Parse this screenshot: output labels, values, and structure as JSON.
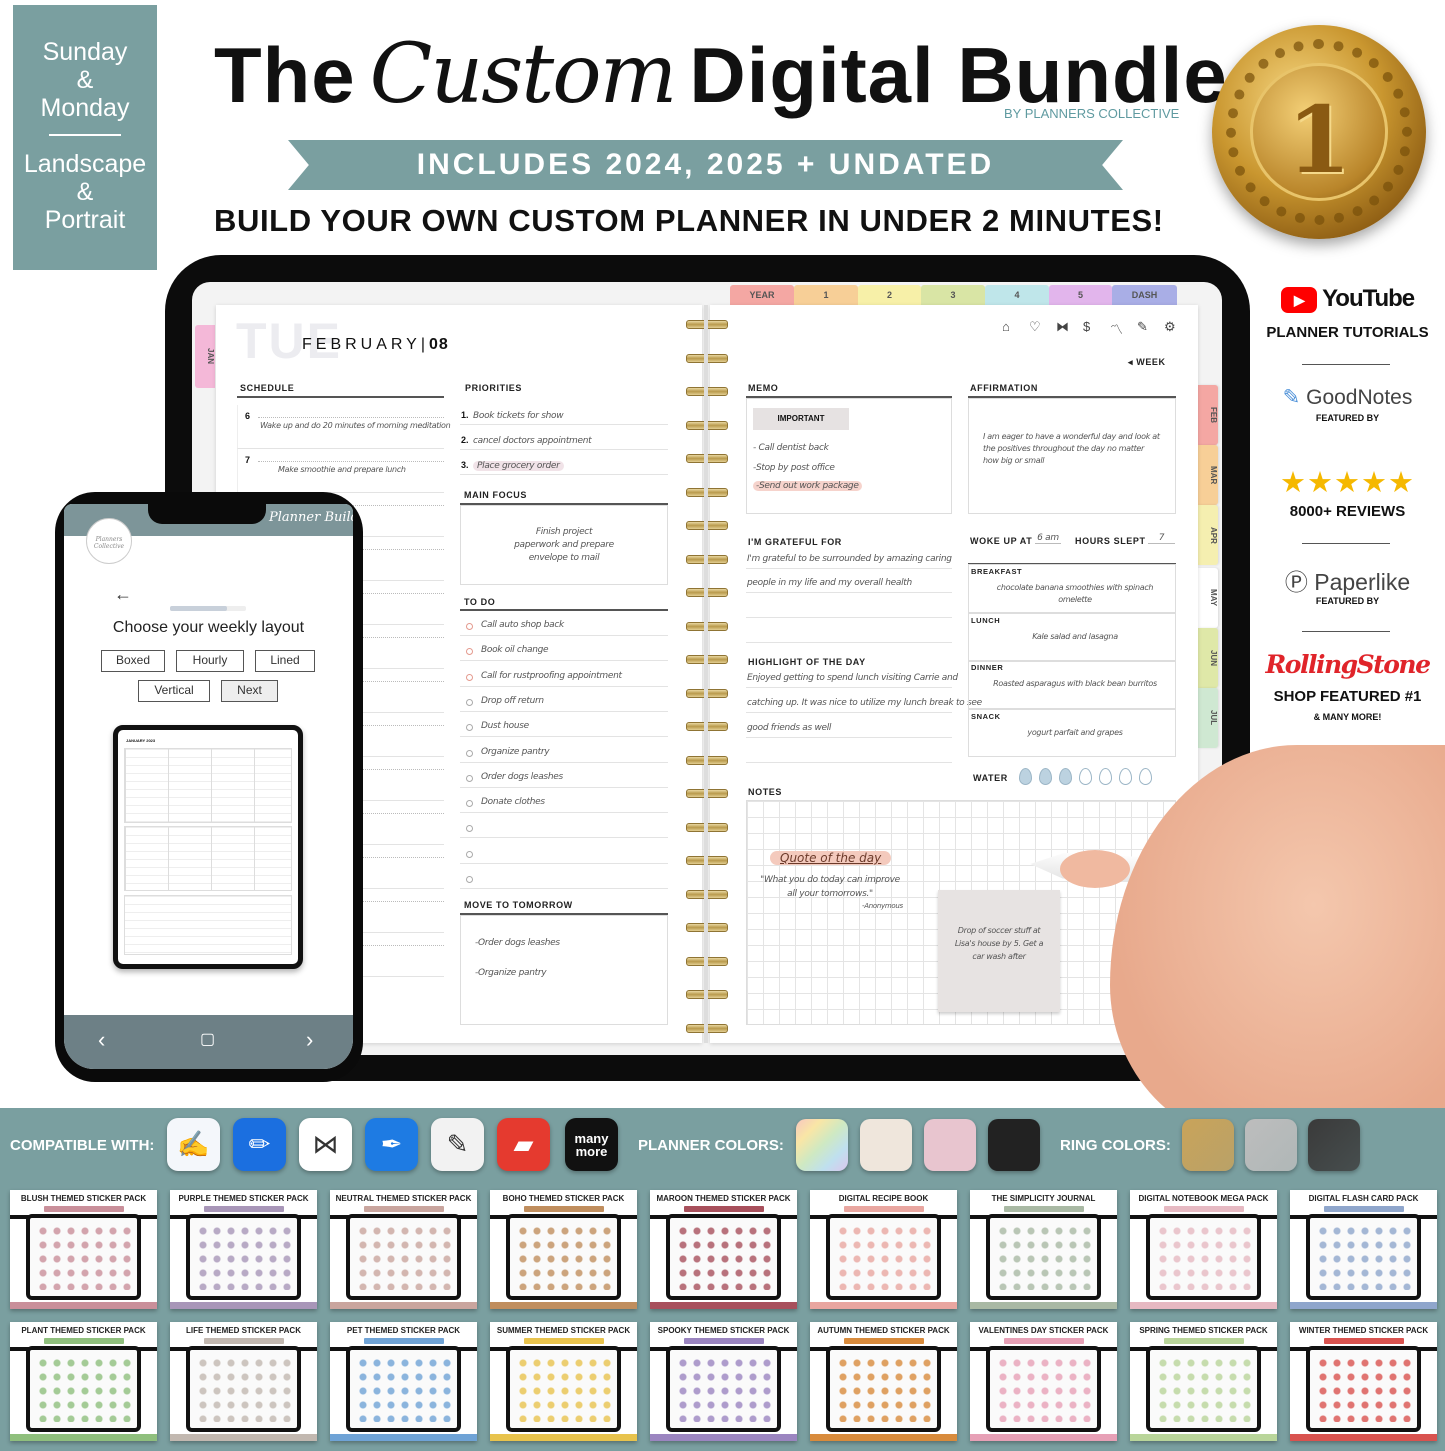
{
  "badge": {
    "line1": "Sunday",
    "line2": "&",
    "line3": "Monday",
    "line4": "Landscape",
    "line5": "&",
    "line6": "Portrait"
  },
  "header": {
    "title_pre": "The",
    "title_script": "Custom",
    "title_post": "Digital Bundle",
    "byline": "BY PLANNERS COLLECTIVE",
    "ribbon": "INCLUDES 2024, 2025 + UNDATED",
    "tagline": "BUILD YOUR OWN CUSTOM PLANNER IN UNDER 2 MINUTES!"
  },
  "medal": {
    "number": "1"
  },
  "sidebar": {
    "youtube": "YouTube",
    "tutorials": "PLANNER TUTORIALS",
    "goodnotes": "GoodNotes",
    "goodnotes_sub": "FEATURED BY",
    "stars": "★★★★★",
    "reviews": "8000+  REVIEWS",
    "paperlike": "Paperlike",
    "paperlike_sub": "FEATURED BY",
    "rollingstone": "RollingStone",
    "shop": "SHOP FEATURED #1",
    "more": "& MANY MORE!"
  },
  "planner": {
    "top_tabs": [
      {
        "label": "YEAR",
        "color": "#f4a7a3"
      },
      {
        "label": "1",
        "color": "#f7cf97"
      },
      {
        "label": "2",
        "color": "#f7f0a8"
      },
      {
        "label": "3",
        "color": "#d9e5a5"
      },
      {
        "label": "4",
        "color": "#bfe6ea"
      },
      {
        "label": "5",
        "color": "#e2b5ec"
      },
      {
        "label": "DASH",
        "color": "#a9aee6"
      }
    ],
    "side_tabs": [
      {
        "label": "FEB",
        "color": "#f4a7a3"
      },
      {
        "label": "MAR",
        "color": "#f7cf97"
      },
      {
        "label": "APR",
        "color": "#f5efb0"
      },
      {
        "label": "MAY",
        "color": "#ffffff"
      },
      {
        "label": "JUN",
        "color": "#dfe8a8"
      },
      {
        "label": "JUL",
        "color": "#cfe8d2"
      }
    ],
    "left_tab": {
      "label": "JAN",
      "color": "#f4b8d8"
    },
    "day": "TUE",
    "month": "FEBRUARY",
    "date": "08",
    "schedule": {
      "heading": "SCHEDULE",
      "rows": [
        {
          "hour": "6",
          "text": "Wake up and do 20 minutes of morning meditation"
        },
        {
          "hour": "7",
          "text": "Make smoothie and prepare lunch"
        }
      ]
    },
    "priorities": {
      "heading": "PRIORITIES",
      "items": [
        {
          "num": "1.",
          "text": "Book tickets for show"
        },
        {
          "num": "2.",
          "text": "cancel doctors appointment"
        },
        {
          "num": "3.",
          "text": "Place grocery order"
        }
      ]
    },
    "main_focus": {
      "heading": "MAIN FOCUS",
      "text": "Finish project paperwork and prepare envelope to mail"
    },
    "todo": {
      "heading": "TO DO",
      "items": [
        {
          "text": "Call auto shop back",
          "done": true
        },
        {
          "text": "Book oil change",
          "done": true
        },
        {
          "text": "Call for rustproofing appointment",
          "done": true
        },
        {
          "text": "Drop off return",
          "done": false
        },
        {
          "text": "Dust house",
          "done": false
        },
        {
          "text": "Organize pantry",
          "done": false
        },
        {
          "text": "Order dogs leashes",
          "done": false
        },
        {
          "text": "Donate clothes",
          "done": false
        },
        {
          "text": "",
          "done": false
        },
        {
          "text": "",
          "done": false
        },
        {
          "text": "",
          "done": false
        }
      ]
    },
    "move": {
      "heading": "MOVE TO TOMORROW",
      "items": [
        "-Order dogs leashes",
        "-Organize pantry"
      ]
    },
    "nav_icons": [
      "home-icon",
      "heart-icon",
      "dumbbell-icon",
      "dollar-icon",
      "chart-icon",
      "pencil-icon",
      "gear-icon"
    ],
    "nav_glyphs": [
      "⌂",
      "♡",
      "⧓",
      "$",
      "〽",
      "✎",
      "⚙"
    ],
    "week_link": "◂ WEEK",
    "memo": {
      "heading": "MEMO",
      "tag": "IMPORTANT",
      "items": [
        "- Call dentist back",
        "-Stop by post office",
        "-Send out work package"
      ]
    },
    "affirmation": {
      "heading": "AFFIRMATION",
      "text": "I am eager to have a wonderful day and look at the positives throughout the day no matter how big or small"
    },
    "grateful": {
      "heading": "I'M GRATEFUL FOR",
      "lines": [
        "I'm grateful to be surrounded by amazing caring",
        "people in my life and my overall health"
      ]
    },
    "highlight": {
      "heading": "HIGHLIGHT OF THE DAY",
      "lines": [
        "Enjoyed getting to spend lunch visiting Carrie and",
        "catching up. It was nice to utilize my lunch break to see",
        "good friends as well"
      ]
    },
    "sleep": {
      "woke_label": "WOKE UP AT",
      "woke_value": "6 am",
      "slept_label": "HOURS SLEPT",
      "slept_value": "7"
    },
    "meals": [
      {
        "label": "BREAKFAST",
        "text": "chocolate banana smoothies with spinach omelette"
      },
      {
        "label": "LUNCH",
        "text": "Kale salad and lasagna"
      },
      {
        "label": "DINNER",
        "text": "Roasted asparagus with black bean burritos"
      },
      {
        "label": "SNACK",
        "text": "yogurt parfait and grapes"
      }
    ],
    "water": {
      "label": "WATER",
      "filled": 3,
      "total": 7
    },
    "notes": {
      "heading": "NOTES",
      "quote_title": "Quote of the day",
      "quote": "\"What you do today can improve all your tomorrows.\"",
      "quote_author": "-Anonymous",
      "sticky": "Drop of soccer stuff at Lisa's house by 5. Get a car wash after"
    }
  },
  "phone": {
    "brand": "Planner Builder",
    "logo": "Planners Collective",
    "back": "←",
    "prompt": "Choose your weekly layout",
    "options": [
      "Boxed",
      "Hourly",
      "Lined",
      "Vertical",
      "Next"
    ],
    "progress": 0.75,
    "preview_title": "JANUARY 2023",
    "nav": [
      "‹",
      "▢",
      "›"
    ]
  },
  "compat": {
    "label": "COMPATIBLE WITH:",
    "apps": [
      {
        "name": "notes-app-icon",
        "glyph": "✍",
        "bg": "#f4f7fb"
      },
      {
        "name": "pencil-app-icon",
        "glyph": "✏",
        "bg": "#1b6fe0"
      },
      {
        "name": "bow-app-icon",
        "glyph": "⋈",
        "bg": "#ffffff"
      },
      {
        "name": "pen-app-icon",
        "glyph": "✒",
        "bg": "#1e7be3"
      },
      {
        "name": "pencil-gray-app-icon",
        "glyph": "✎",
        "bg": "#f2f2f2"
      },
      {
        "name": "red-notes-app-icon",
        "glyph": "▰",
        "bg": "#e53a2f"
      }
    ],
    "many_more": "many more"
  },
  "planner_colors": {
    "label": "PLANNER COLORS:",
    "swatches": [
      "rainbow",
      "#efe6dc",
      "#e8c5cf",
      "#222222"
    ]
  },
  "ring_colors": {
    "label": "RING COLORS:",
    "swatches": [
      "#c9a35a",
      "#bdbdbd",
      "#3a3a3a"
    ]
  },
  "packs": [
    {
      "title": "BLUSH THEMED STICKER PACK",
      "color": "#c98f9a"
    },
    {
      "title": "PURPLE THEMED STICKER PACK",
      "color": "#a896b8"
    },
    {
      "title": "NEUTRAL THEMED STICKER PACK",
      "color": "#c9a59e"
    },
    {
      "title": "BOHO THEMED STICKER PACK",
      "color": "#c08e5e"
    },
    {
      "title": "MAROON THEMED STICKER PACK",
      "color": "#a8505c"
    },
    {
      "title": "DIGITAL RECIPE BOOK",
      "color": "#e9a6a0"
    },
    {
      "title": "THE SIMPLICITY JOURNAL",
      "color": "#a9b9a4"
    },
    {
      "title": "DIGITAL NOTEBOOK MEGA PACK",
      "color": "#e6b9c2"
    },
    {
      "title": "DIGITAL FLASH CARD PACK",
      "color": "#8fa6cc"
    },
    {
      "title": "PLANT THEMED STICKER PACK",
      "color": "#8fbf7d"
    },
    {
      "title": "LIFE THEMED STICKER PACK",
      "color": "#c2b8b0"
    },
    {
      "title": "PET THEMED STICKER PACK",
      "color": "#6fa3d6"
    },
    {
      "title": "SUMMER THEMED STICKER PACK",
      "color": "#e8c34d"
    },
    {
      "title": "SPOOKY THEMED STICKER PACK",
      "color": "#9b85c0"
    },
    {
      "title": "AUTUMN THEMED STICKER PACK",
      "color": "#d88b3c"
    },
    {
      "title": "VALENTINES DAY STICKER PACK",
      "color": "#e7a0b6"
    },
    {
      "title": "SPRING THEMED STICKER PACK",
      "color": "#b9d59a"
    },
    {
      "title": "WINTER THEMED STICKER PACK",
      "color": "#d9534f"
    }
  ]
}
